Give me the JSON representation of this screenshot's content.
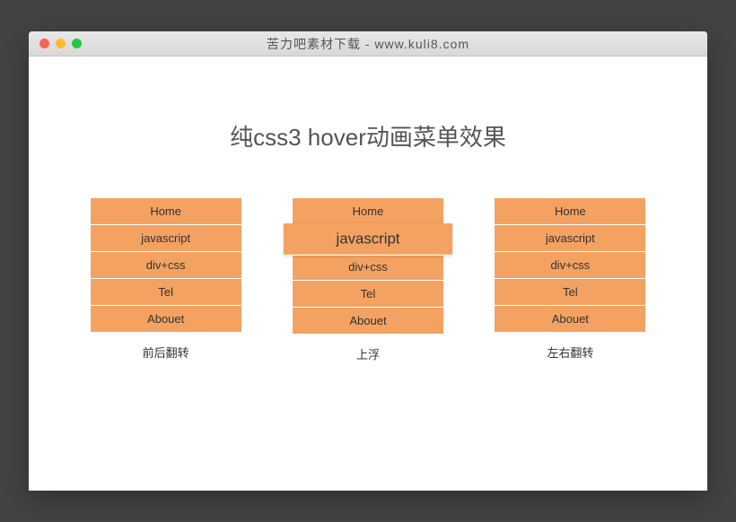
{
  "window": {
    "title": "苦力吧素材下载 - www.kuli8.com"
  },
  "heading": "纯css3 hover动画菜单效果",
  "menus": {
    "items": [
      "Home",
      "javascript",
      "div+css",
      "Tel",
      "Abouet"
    ]
  },
  "columns": [
    {
      "caption": "前后翻转",
      "hoverIndex": -1
    },
    {
      "caption": "上浮",
      "hoverIndex": 1
    },
    {
      "caption": "左右翻转",
      "hoverIndex": -1
    }
  ],
  "colors": {
    "menuBg": "#f4a261",
    "bodyBg": "#434343"
  }
}
